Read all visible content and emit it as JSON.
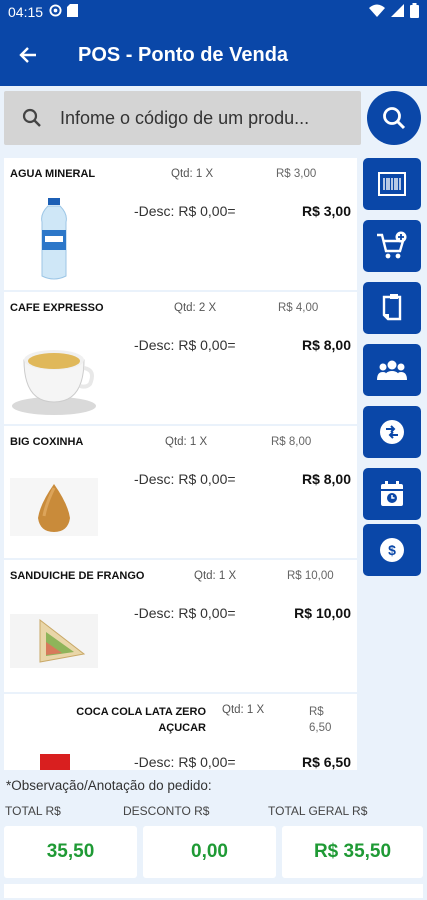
{
  "status_bar": {
    "time": "04:15"
  },
  "app_bar": {
    "title": "POS - Ponto de Venda"
  },
  "search": {
    "placeholder": "Infome o código de um produ..."
  },
  "items": [
    {
      "name": "AGUA MINERAL",
      "qty": "Qtd: 1  X",
      "unit_price": "R$ 3,00",
      "desc": "-Desc: R$ 0,00=",
      "total": "R$ 3,00",
      "image": "water-bottle"
    },
    {
      "name": "CAFE EXPRESSO",
      "qty": "Qtd: 2  X",
      "unit_price": "R$ 4,00",
      "desc": "-Desc: R$ 0,00=",
      "total": "R$ 8,00",
      "image": "coffee-cup"
    },
    {
      "name": "BIG COXINHA",
      "qty": "Qtd: 1  X",
      "unit_price": "R$ 8,00",
      "desc": "-Desc: R$ 0,00=",
      "total": "R$ 8,00",
      "image": "coxinha"
    },
    {
      "name": "SANDUICHE DE FRANGO",
      "qty": "Qtd: 1  X",
      "unit_price": "R$ 10,00",
      "desc": "-Desc: R$ 0,00=",
      "total": "R$ 10,00",
      "image": "sandwich"
    },
    {
      "name_line1": "COCA COLA LATA ZERO",
      "name_line2": "AÇUCAR",
      "qty": "Qtd: 1  X",
      "unit_price_line1": "R$",
      "unit_price_line2": "6,50",
      "desc": "-Desc: R$ 0,00=",
      "total": "R$ 6,50",
      "image": "soda-can"
    }
  ],
  "side_buttons": [
    "barcode-icon",
    "add-to-cart-icon",
    "document-icon",
    "customers-icon",
    "discount-icon",
    "calendar-clock-icon",
    "payment-icon"
  ],
  "footer": {
    "observation": "*Observação/Anotação do pedido:",
    "total_label": "TOTAL R$",
    "discount_label": "DESCONTO R$",
    "grand_total_label": "TOTAL GERAL R$",
    "total_value": "35,50",
    "discount_value": "0,00",
    "grand_total_value": "R$ 35,50"
  },
  "colors": {
    "primary": "#0a47a8",
    "background": "#eaf2fb",
    "value_green": "#1f9a35"
  }
}
